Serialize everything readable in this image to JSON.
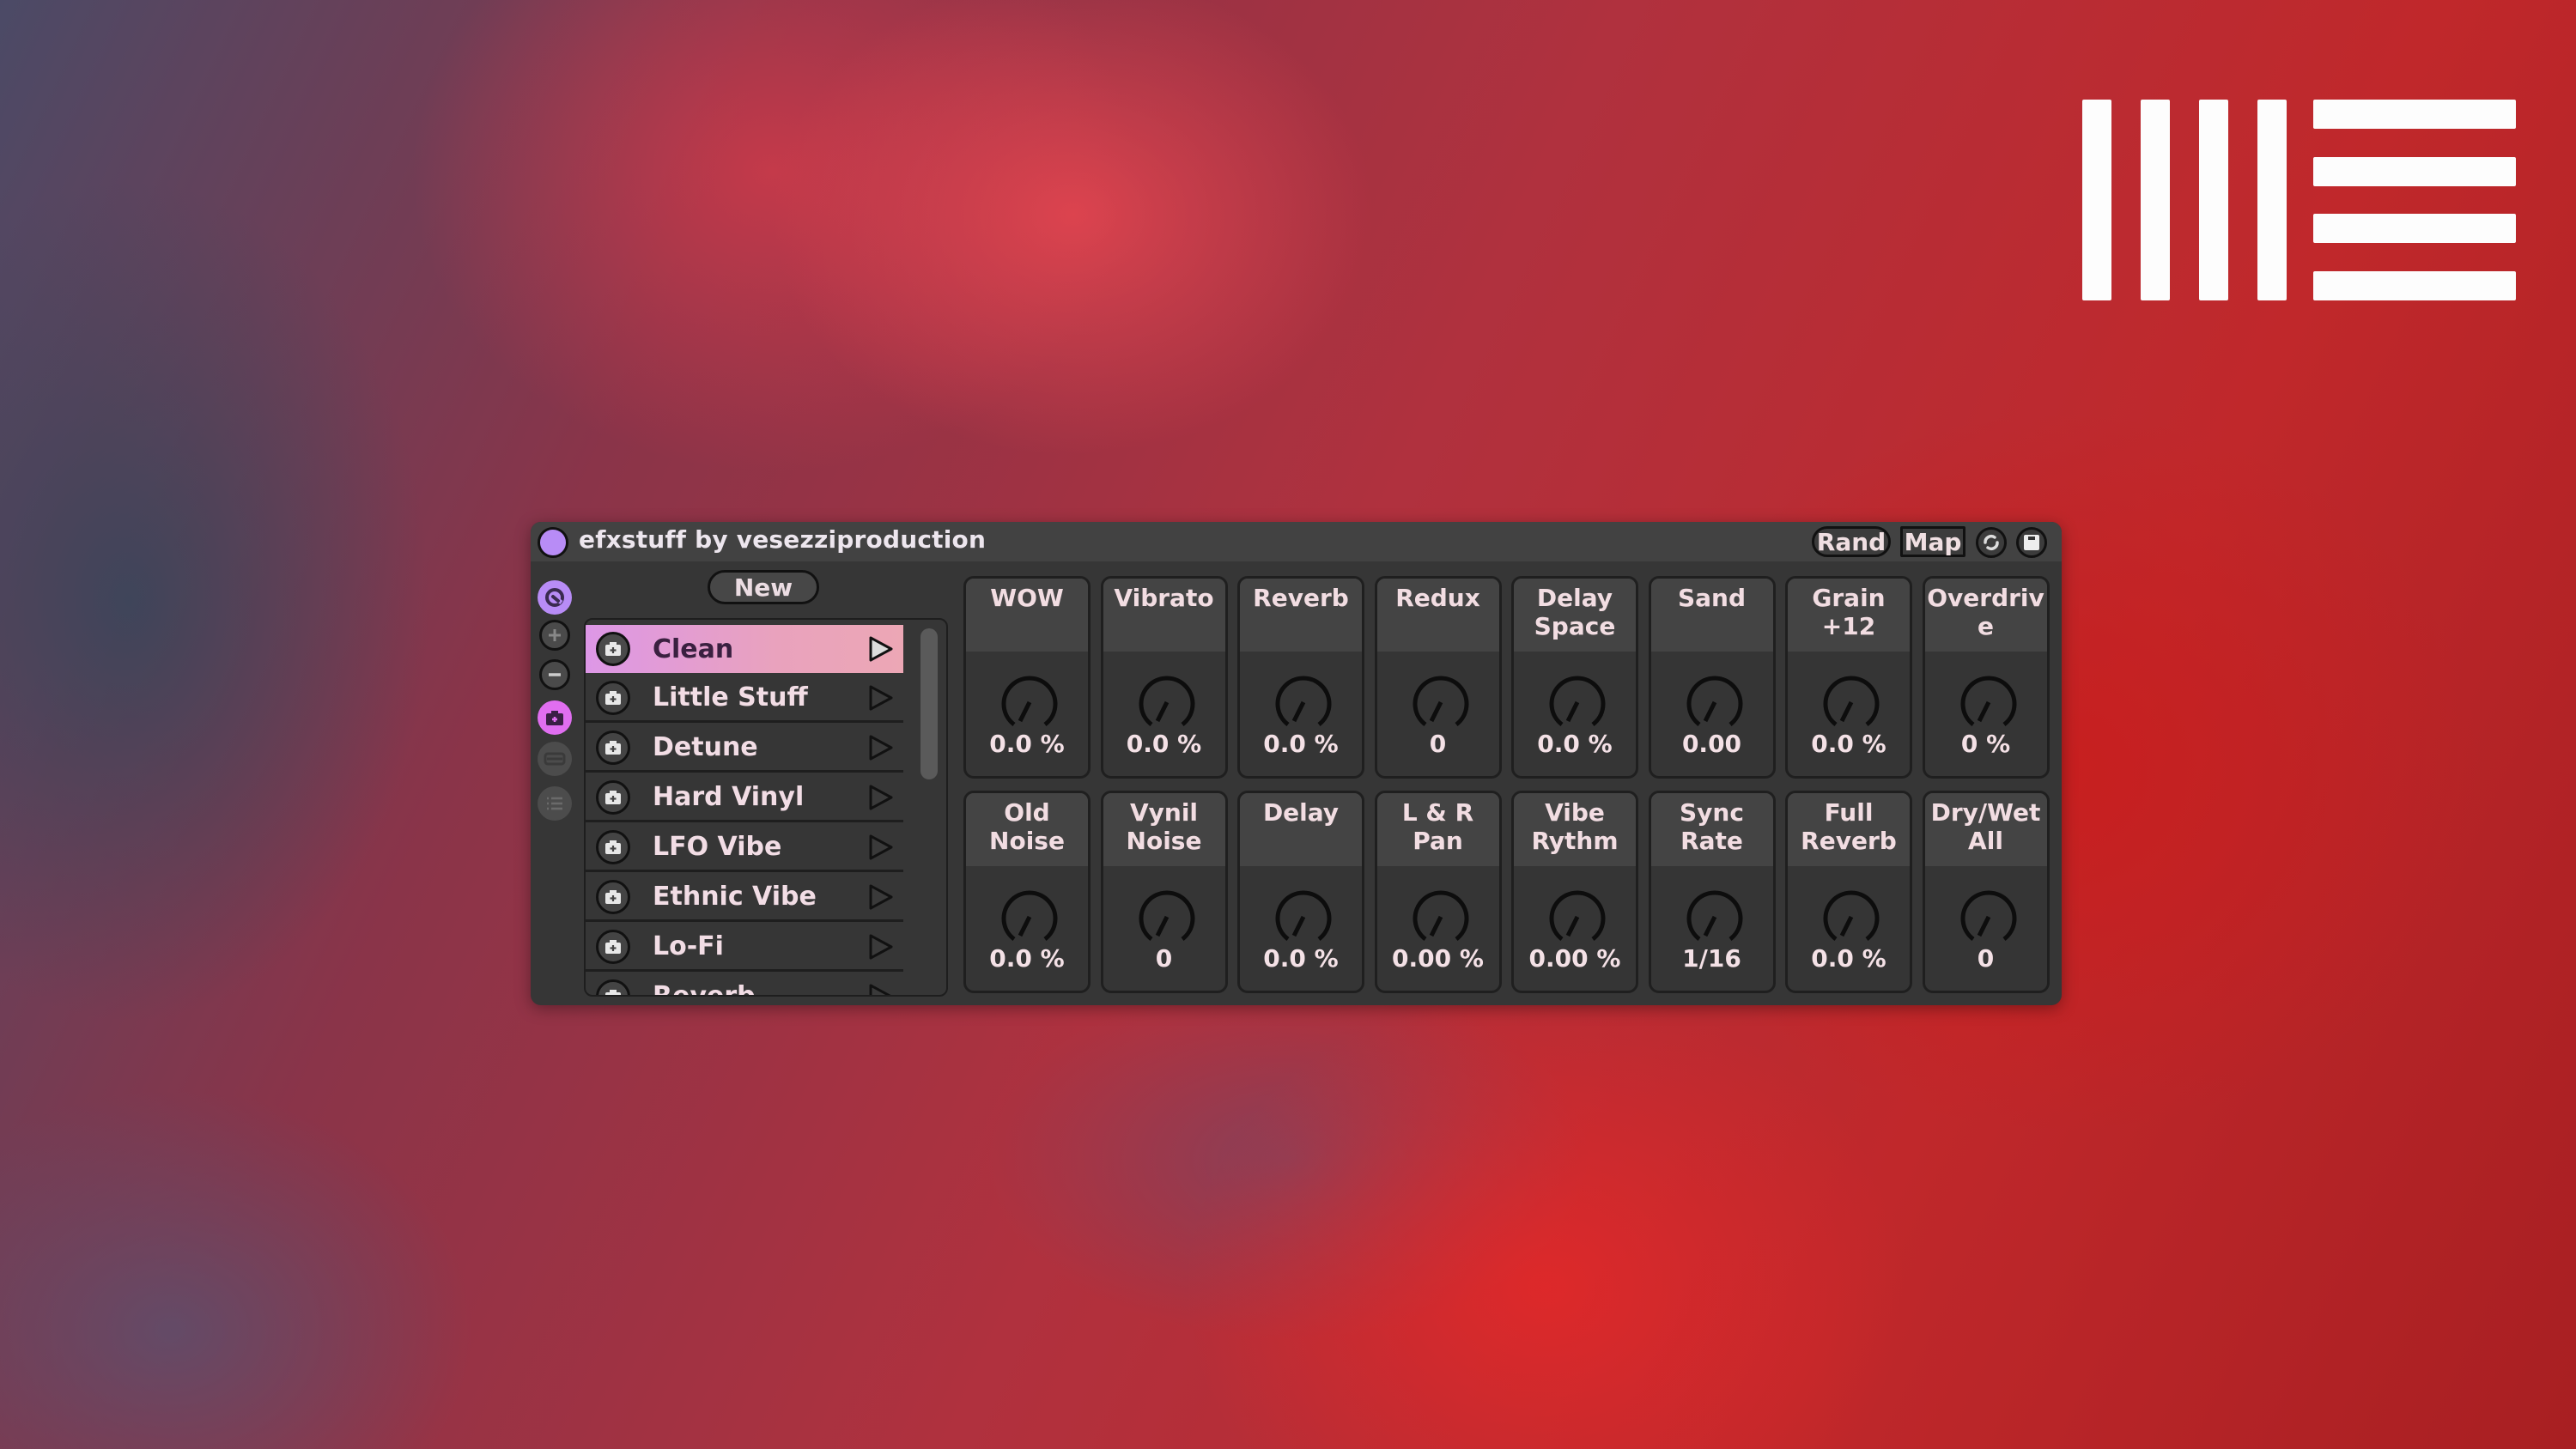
{
  "device": {
    "title": "efxstuff by vesezziproduction",
    "accent_color": "#b88cf6",
    "preset_accent_color": "#e06ef0",
    "toolbar": {
      "rand_label": "Rand",
      "map_label": "Map",
      "sync_icon": "sync-icon",
      "save_icon": "save-icon"
    },
    "side_icons": [
      "power-icon",
      "plus-icon",
      "minus-icon",
      "camera-icon",
      "bar-icon",
      "list-icon"
    ],
    "new_label": "New",
    "presets": [
      {
        "name": "Clean",
        "selected": true
      },
      {
        "name": "Little Stuff",
        "selected": false
      },
      {
        "name": "Detune",
        "selected": false
      },
      {
        "name": "Hard Vinyl",
        "selected": false
      },
      {
        "name": "LFO Vibe",
        "selected": false
      },
      {
        "name": "Ethnic Vibe",
        "selected": false
      },
      {
        "name": "Lo-Fi",
        "selected": false
      },
      {
        "name": "Reverb",
        "selected": false
      }
    ],
    "knobs": [
      {
        "label": "WOW",
        "value": "0.0 %"
      },
      {
        "label": "Vibrato",
        "value": "0.0 %"
      },
      {
        "label": "Reverb",
        "value": "0.0 %"
      },
      {
        "label": "Redux",
        "value": "0"
      },
      {
        "label": "Delay\nSpace",
        "value": "0.0 %"
      },
      {
        "label": "Sand",
        "value": "0.00"
      },
      {
        "label": "Grain\n+12",
        "value": "0.0 %"
      },
      {
        "label": "Overdriv\ne",
        "value": "0 %"
      },
      {
        "label": "Old\nNoise",
        "value": "0.0 %"
      },
      {
        "label": "Vynil\nNoise",
        "value": "0"
      },
      {
        "label": "Delay",
        "value": "0.0 %"
      },
      {
        "label": "L & R\nPan",
        "value": "0.00 %"
      },
      {
        "label": "Vibe\nRythm",
        "value": "0.00 %"
      },
      {
        "label": "Sync\nRate",
        "value": "1/16"
      },
      {
        "label": "Full\nReverb",
        "value": "0.0 %"
      },
      {
        "label": "Dry/Wet\nAll",
        "value": "0"
      }
    ]
  },
  "logo": {
    "name": "ableton-logo",
    "color": "#fdfdfd"
  }
}
